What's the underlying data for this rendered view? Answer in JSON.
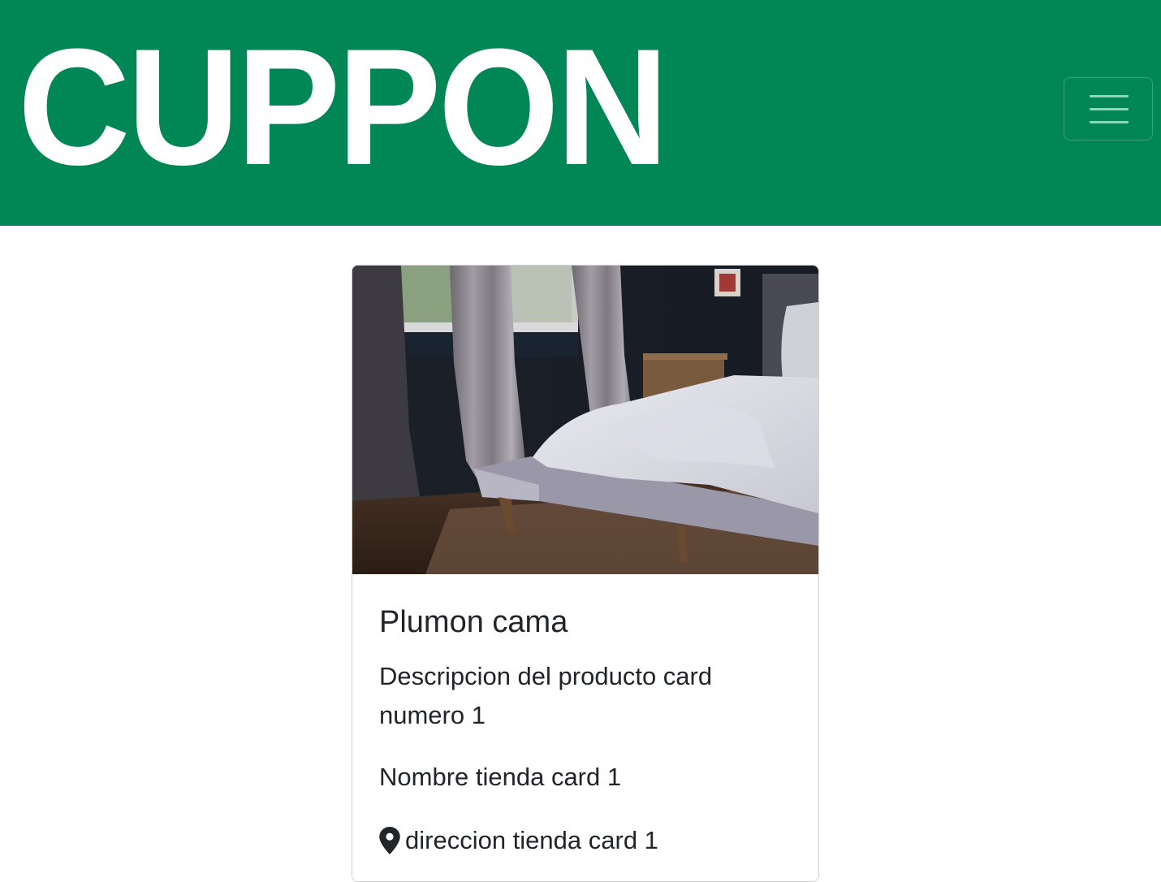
{
  "brand": {
    "name": "CUPPON",
    "color": "#008755"
  },
  "navbar": {
    "toggler_icon": "hamburger-menu-icon"
  },
  "card": {
    "image_alt": "bedroom with bed and curtains",
    "title": "Plumon cama",
    "description": "Descripcion del producto card numero 1",
    "store_name": "Nombre tienda card 1",
    "address_icon": "map-pin-icon",
    "address": "direccion tienda card 1"
  }
}
